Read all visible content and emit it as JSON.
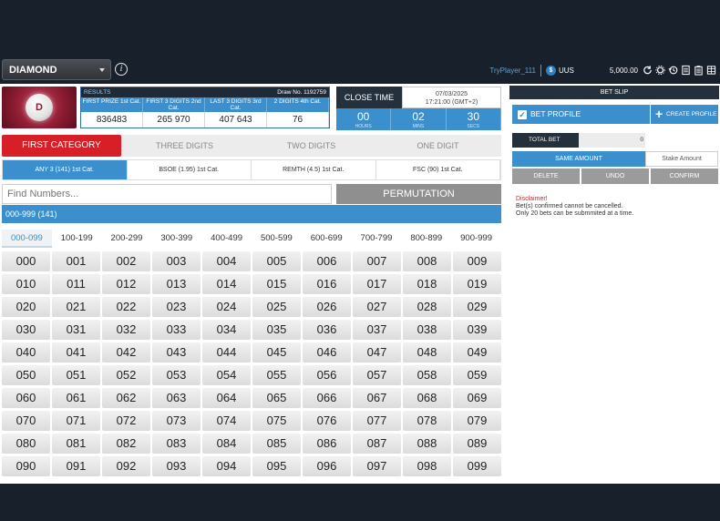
{
  "header": {
    "game": "DIAMOND",
    "username": "TryPlayer_111",
    "currency": "UUS",
    "balance": "5,000.00"
  },
  "logo": {
    "letter": "D"
  },
  "results": {
    "label": "RESULTS",
    "draw": "Draw No. 1192759",
    "columns": [
      "FIRST PRIZE 1st Cat.",
      "FIRST 3 DIGITS 2nd Cat.",
      "LAST 3 DIGITS 3rd Cat.",
      "2 DIGITS 4th Cat."
    ],
    "values": [
      "836483",
      "265 970",
      "407 643",
      "76"
    ]
  },
  "close_time": {
    "label": "CLOSE TIME",
    "date": "07/03/2025",
    "time": "17:21:00 (GMT+2)",
    "hours": "00",
    "hours_label": "HOURS",
    "minutes": "02",
    "minutes_label": "MINS",
    "seconds": "30",
    "seconds_label": "SECS"
  },
  "category_tabs": [
    "FIRST CATEGORY",
    "THREE DIGITS",
    "TWO DIGITS",
    "ONE DIGIT"
  ],
  "bet_type_tabs": [
    "ANY 3 (141) 1st Cat.",
    "BSOE (1.95) 1st Cat.",
    "REMTH (4.5) 1st Cat.",
    "FSC (90) 1st Cat."
  ],
  "search": {
    "placeholder": "Find Numbers..."
  },
  "permutation_label": "PERMUTATION",
  "range_label": "000-999 (141)",
  "hundreds": [
    "000-099",
    "100-199",
    "200-299",
    "300-399",
    "400-499",
    "500-599",
    "600-699",
    "700-799",
    "800-899",
    "900-999"
  ],
  "numbers": [
    "000",
    "001",
    "002",
    "003",
    "004",
    "005",
    "006",
    "007",
    "008",
    "009",
    "010",
    "011",
    "012",
    "013",
    "014",
    "015",
    "016",
    "017",
    "018",
    "019",
    "020",
    "021",
    "022",
    "023",
    "024",
    "025",
    "026",
    "027",
    "028",
    "029",
    "030",
    "031",
    "032",
    "033",
    "034",
    "035",
    "036",
    "037",
    "038",
    "039",
    "040",
    "041",
    "042",
    "043",
    "044",
    "045",
    "046",
    "047",
    "048",
    "049",
    "050",
    "051",
    "052",
    "053",
    "054",
    "055",
    "056",
    "057",
    "058",
    "059",
    "060",
    "061",
    "062",
    "063",
    "064",
    "065",
    "066",
    "067",
    "068",
    "069",
    "070",
    "071",
    "072",
    "073",
    "074",
    "075",
    "076",
    "077",
    "078",
    "079",
    "080",
    "081",
    "082",
    "083",
    "084",
    "085",
    "086",
    "087",
    "088",
    "089",
    "090",
    "091",
    "092",
    "093",
    "094",
    "095",
    "096",
    "097",
    "098",
    "099"
  ],
  "bet_slip": {
    "title": "BET SLIP",
    "bet_profile": "BET PROFILE",
    "create_profile": "CREATE PROFILE",
    "total_bet_label": "TOTAL BET",
    "total_bet_value": "0",
    "same_amount": "SAME AMOUNT",
    "stake_amount": "Stake Amount",
    "delete": "DELETE",
    "undo": "UNDO",
    "confirm": "CONFIRM",
    "disclaimer_title": "Disclaimer!",
    "disclaimer_1": "Bet(s) confirmed cannot be cancelled.",
    "disclaimer_2": "Only 20 bets can be submmited at a time."
  },
  "colors": {
    "accent": "#3b8fcc",
    "red": "#d61f26",
    "dark": "#24303c"
  }
}
